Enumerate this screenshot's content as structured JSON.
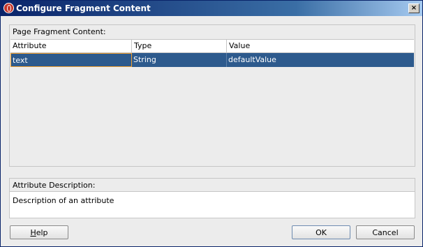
{
  "window": {
    "title": "Configure Fragment Content",
    "close_glyph": "×"
  },
  "fragment_group": {
    "label": "Page Fragment Content:",
    "columns": [
      "Attribute",
      "Type",
      "Value"
    ],
    "rows": [
      {
        "attribute": "text",
        "type": "String",
        "value": "defaultValue",
        "selected": true
      }
    ]
  },
  "description_group": {
    "label": "Attribute Description:",
    "text": "Description of an attribute"
  },
  "buttons": {
    "help_mnemonic": "H",
    "help_rest": "elp",
    "ok": "OK",
    "cancel": "Cancel"
  },
  "colors": {
    "title_bar": "#0a246a",
    "selection": "#2d5a8d",
    "focus_border": "#f0a030"
  },
  "icons": {
    "app": "oracle-icon",
    "close": "close-icon"
  }
}
